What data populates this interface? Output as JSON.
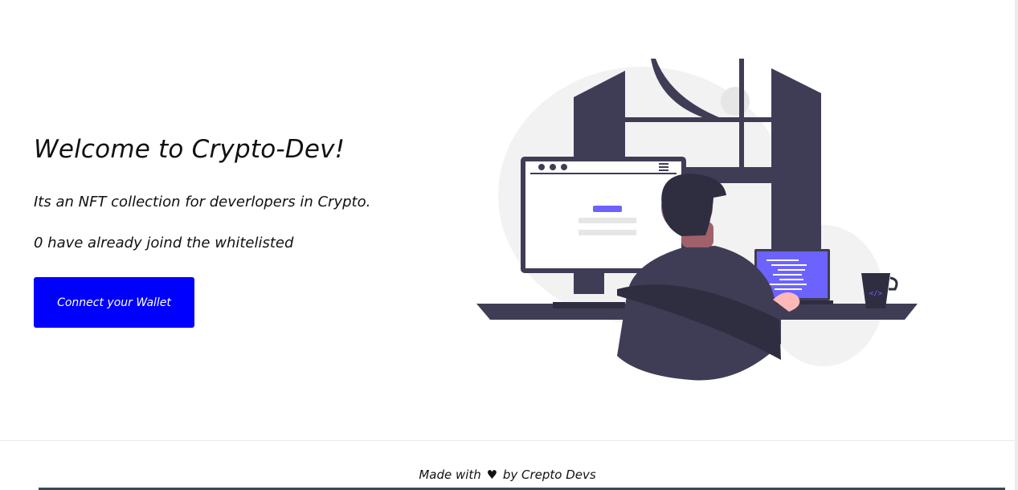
{
  "hero": {
    "title": "Welcome to Crypto-Dev!",
    "description": "Its an NFT collection for deverlopers in Crypto.",
    "whitelist_status": "0 have already joind the whitelisted",
    "connect_button_label": "Connect your Wallet"
  },
  "illustration": {
    "icon": "developer-at-desk-illustration",
    "accent_color": "#6c63ff",
    "dark_color": "#3f3d56"
  },
  "footer": {
    "prefix": "Made with",
    "heart_icon": "♥",
    "suffix": "by Crepto Devs"
  },
  "colors": {
    "button_background": "#0000ff",
    "button_text": "#ffffff",
    "text": "#111111"
  }
}
